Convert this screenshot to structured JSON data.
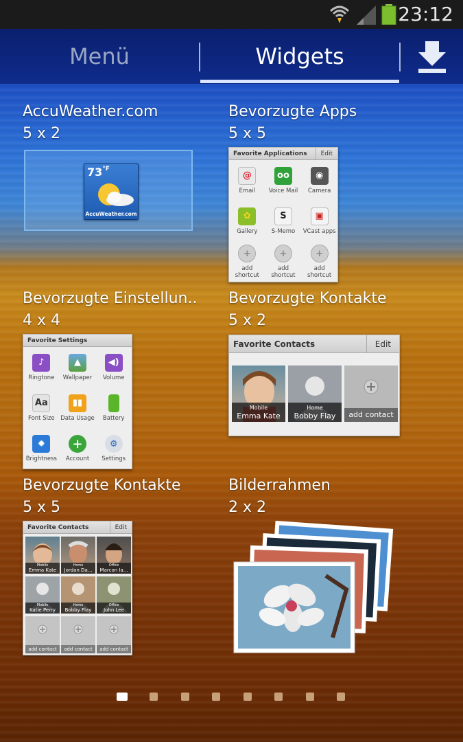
{
  "status": {
    "time": "23:12"
  },
  "tabs": [
    {
      "label": "Menü",
      "active": false
    },
    {
      "label": "Widgets",
      "active": true
    }
  ],
  "widgets": {
    "accuweather": {
      "title": "AccuWeather.com",
      "size": "5 x 2",
      "temp": "73",
      "unit": "°F",
      "brand": "AccuWeather.com"
    },
    "apps": {
      "title": "Bevorzugte Apps",
      "size": "5 x 5",
      "header": "Favorite Applications",
      "edit": "Edit",
      "items": [
        "Email",
        "Voice Mail",
        "Camera",
        "Gallery",
        "S-Memo",
        "VCast apps",
        "add shortcut",
        "add shortcut",
        "add shortcut"
      ]
    },
    "settings": {
      "title": "Bevorzugte Einstellun..",
      "size": "4 x 4",
      "header": "Favorite Settings",
      "items": [
        "Ringtone",
        "Wallpaper",
        "Volume",
        "Font Size",
        "Data Usage",
        "Battery",
        "Brightness",
        "Account",
        "Settings"
      ]
    },
    "contacts52": {
      "title": "Bevorzugte Kontakte",
      "size": "5 x 2",
      "header": "Favorite Contacts",
      "edit": "Edit",
      "contacts": [
        {
          "type": "Mobile",
          "name": "Emma Kate"
        },
        {
          "type": "Home",
          "name": "Bobby Flay"
        }
      ],
      "add": "add contact"
    },
    "contacts55": {
      "title": "Bevorzugte Kontakte",
      "size": "5 x 5",
      "header": "Favorite Contacts",
      "edit": "Edit",
      "contacts": [
        {
          "type": "Mobile",
          "name": "Emma Kate"
        },
        {
          "type": "Home",
          "name": "Jordan Da..."
        },
        {
          "type": "Office",
          "name": "Marcon Ia..."
        },
        {
          "type": "Mobile",
          "name": "Katie Perry"
        },
        {
          "type": "Home",
          "name": "Bobby Flay"
        },
        {
          "type": "Office",
          "name": "John Lee"
        }
      ],
      "add": [
        "add contact",
        "add contact",
        "add contact"
      ]
    },
    "frame": {
      "title": "Bilderrahmen",
      "size": "2 x 2"
    }
  },
  "pagination": {
    "count": 8,
    "active": 0
  }
}
